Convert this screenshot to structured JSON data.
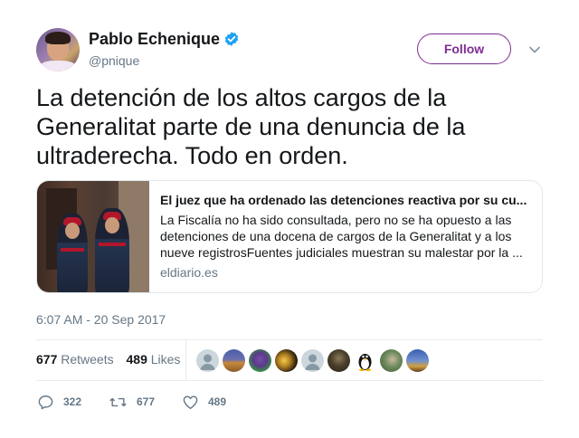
{
  "author": {
    "display_name": "Pablo Echenique",
    "handle": "@pnique",
    "verified": true
  },
  "header": {
    "follow_label": "Follow",
    "caret_icon": "chevron-down-icon"
  },
  "tweet": {
    "text": "La detención de los altos cargos de la Generalitat parte de una denuncia de la ultraderecha. Todo en orden.",
    "timestamp": "6:07 AM - 20 Sep 2017"
  },
  "card": {
    "title": "El juez que ha ordenado las detenciones reactiva por su cu...",
    "description": "La Fiscalía no ha sido consultada, pero no se ha opuesto a las detenciones de una docena de cargos de la Generalitat y a los nueve registrosFuentes judiciales muestran su malestar por la ...",
    "domain": "eldiario.es"
  },
  "stats": {
    "retweets_count": "677",
    "retweets_label": "Retweets",
    "likes_count": "489",
    "likes_label": "Likes"
  },
  "likers_count_shown": 9,
  "actions": {
    "reply_count": "322",
    "retweet_count": "677",
    "like_count": "489"
  },
  "colors": {
    "accent": "#7e2c91",
    "verified": "#1da1f2",
    "muted": "#657786",
    "text": "#14171a",
    "border": "#e1e8ed"
  }
}
